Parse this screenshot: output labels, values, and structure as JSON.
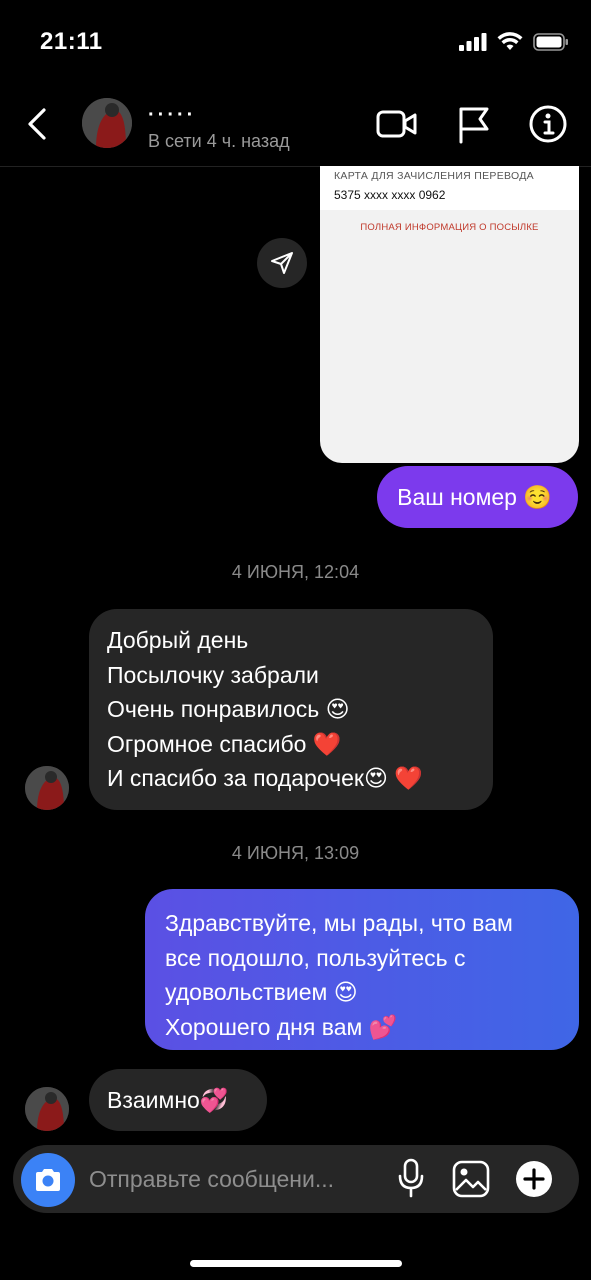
{
  "status_bar": {
    "time": "21:11"
  },
  "header": {
    "username": "·····",
    "status": "В сети 4 ч. назад",
    "icons": [
      "back-icon",
      "video-call-icon",
      "flag-icon",
      "info-icon"
    ]
  },
  "card": {
    "caption": "КАРТА ДЛЯ ЗАЧИСЛЕНИЯ ПЕРЕВОДА",
    "number": "5375 xxxx xxxx 0962",
    "link": "ПОЛНАЯ ИНФОРМАЦИЯ О ПОСЫЛКЕ"
  },
  "messages": {
    "out1": "Ваш номер ☺️",
    "stamp1": "4 ИЮНЯ, 12:04",
    "in1": [
      "Добрый день",
      "Посылочку забрали",
      "Очень понравилось 😍",
      "Огромное спасибо ❤️",
      "И спасибо за подарочек😍 ❤️"
    ],
    "stamp2": "4 ИЮНЯ, 13:09",
    "out2": [
      "Здравствуйте, мы рады, что вам",
      "все подошло, пользуйтесь с",
      "удовольствием 😍",
      "Хорошего дня вам 💕"
    ],
    "in2": "Взаимно💞"
  },
  "composer": {
    "placeholder": "Отправьте сообщени..."
  },
  "colors": {
    "accent_purple": "#7c3aed",
    "accent_blue": "#3f66e6",
    "bubble_in": "#262626",
    "camera": "#3b82f6"
  }
}
